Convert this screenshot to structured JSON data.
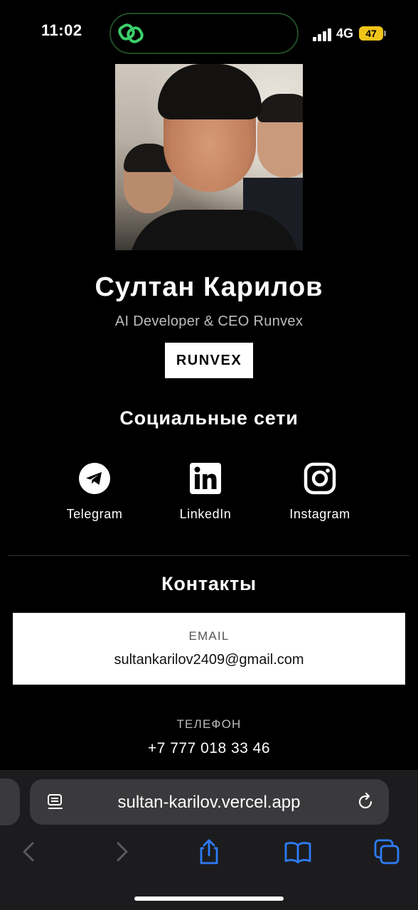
{
  "status_bar": {
    "time": "11:02",
    "network": "4G",
    "battery": "47"
  },
  "profile": {
    "name": "Султан Карилов",
    "role": "AI Developer & CEO Runvex",
    "brand": "RUNVEX"
  },
  "social": {
    "title": "Социальные сети",
    "items": [
      {
        "label": "Telegram",
        "icon": "telegram-icon"
      },
      {
        "label": "LinkedIn",
        "icon": "linkedin-icon"
      },
      {
        "label": "Instagram",
        "icon": "instagram-icon"
      }
    ]
  },
  "contacts": {
    "title": "Контакты",
    "email_label": "EMAIL",
    "email": "sultankarilov2409@gmail.com",
    "phone_label": "ТЕЛЕФОН",
    "phone": "+7 777 018 33 46"
  },
  "browser": {
    "url": "sultan-karilov.vercel.app"
  },
  "colors": {
    "accent": "#2e7cf6",
    "island_ring": "#1f4d24",
    "island_icon": "#3ad06a",
    "battery": "#f0c419"
  }
}
